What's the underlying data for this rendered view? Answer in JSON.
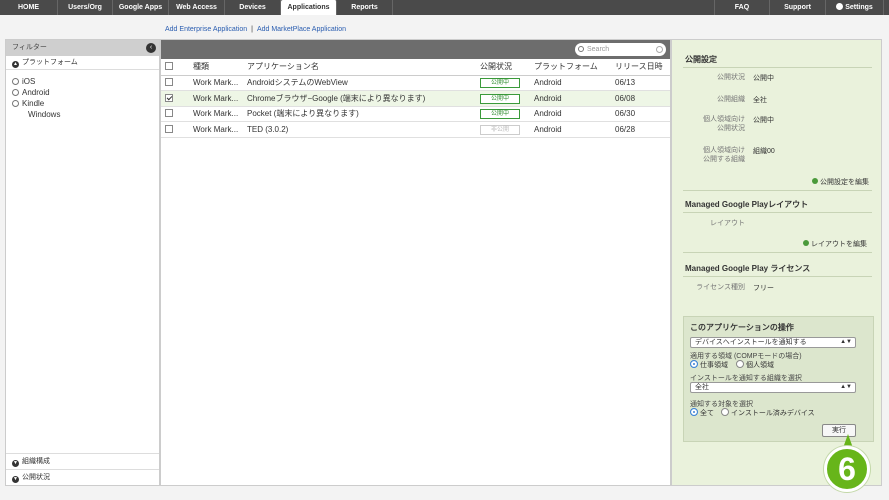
{
  "nav": {
    "left": [
      "HOME",
      "Users/Org",
      "Google Apps",
      "Web Access",
      "Devices",
      "Applications",
      "Reports"
    ],
    "active": "Applications",
    "right": [
      "FAQ",
      "Support",
      "Settings"
    ]
  },
  "links": {
    "add_enterprise": "Add Enterprise Application",
    "separator": "|",
    "add_marketplace": "Add MarketPlace Application"
  },
  "filter": {
    "title": "フィルター",
    "collapse_glyph": "‹",
    "platform_section": "プラットフォーム",
    "platforms": [
      "iOS",
      "Android",
      "Kindle"
    ],
    "platform_sub": "Windows",
    "bottom_sections": [
      "組織構成",
      "公開状況"
    ]
  },
  "search": {
    "placeholder": "Search"
  },
  "table": {
    "headers": [
      "種類",
      "アプリケーション名",
      "公開状況",
      "プラットフォーム",
      "リリース日時"
    ],
    "rows": [
      {
        "type": "Work Mark...",
        "name": "AndroidシステムのWebView",
        "status": "公開中",
        "platform": "Android",
        "date": "06/13",
        "checked": false
      },
      {
        "type": "Work Mark...",
        "name": "Chromeブラウザ−Google (端末により異なります)",
        "status": "公開中",
        "platform": "Android",
        "date": "06/08",
        "checked": true
      },
      {
        "type": "Work Mark...",
        "name": "Pocket (端末により異なります)",
        "status": "公開中",
        "platform": "Android",
        "date": "06/30",
        "checked": false
      },
      {
        "type": "Work Mark...",
        "name": "TED (3.0.2)",
        "status": "非公開",
        "platform": "Android",
        "date": "06/28",
        "checked": false
      }
    ]
  },
  "right": {
    "publish_title": "公開設定",
    "publish_status_label": "公開状況",
    "publish_status_value": "公開中",
    "publish_org_label": "公開組織",
    "publish_org_value": "全社",
    "personal_status_label_1": "個人領域向け",
    "personal_status_label_2": "公開状況",
    "personal_status_value": "公開中",
    "personal_org_label_1": "個人領域向け",
    "personal_org_label_2": "公開する組織",
    "personal_org_value": "組織00",
    "publish_edit": "公開設定を編集",
    "layout_title": "Managed Google Playレイアウト",
    "layout_label": "レイアウト",
    "layout_edit": "レイアウトを編集",
    "license_title": "Managed Google Play ライセンス",
    "license_label": "ライセンス種別",
    "license_value": "フリー",
    "ops_title": "このアプリケーションの操作",
    "action_select": "デバイスへインストールを通知する",
    "area_label": "適用する領域 (COMPモードの場合)",
    "area_work": "仕事領域",
    "area_personal": "個人領域",
    "org_label": "インストールを通知する組織を選択",
    "org_select": "全社",
    "target_label": "通知する対象を選択",
    "target_all": "全て",
    "target_installed": "インストール済みデバイス",
    "run_button": "実行"
  },
  "step_badge": "6",
  "colors": {
    "accent_green": "#67b51a",
    "link_blue": "#2a5db0",
    "nav_bg": "#4a4a4a"
  }
}
